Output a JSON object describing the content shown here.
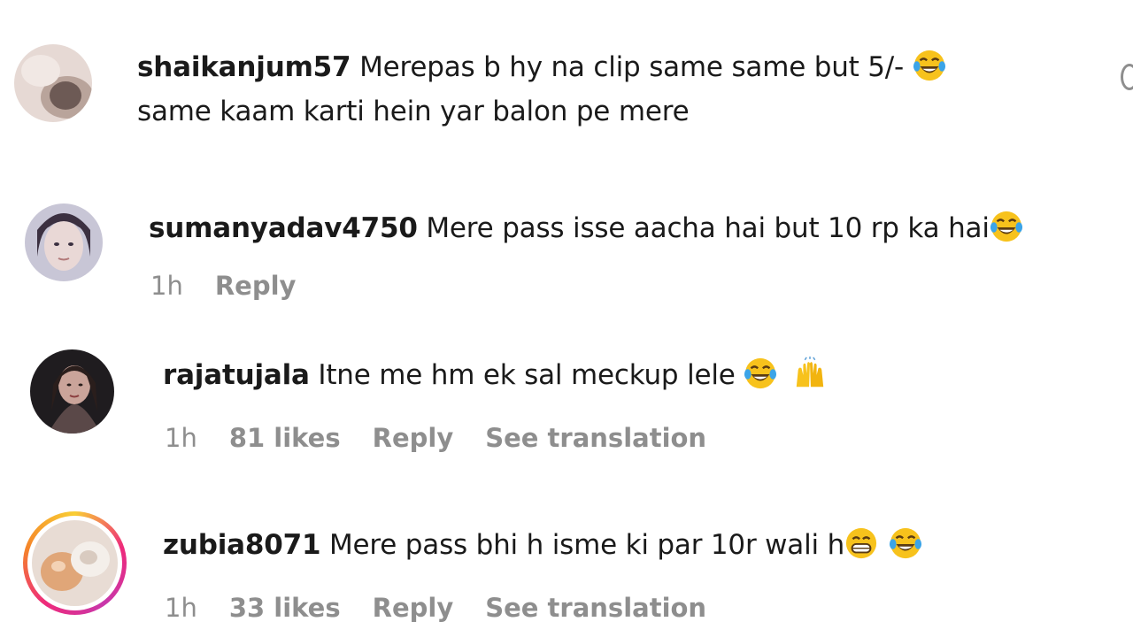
{
  "comments": [
    {
      "username": "shaikanjum57",
      "text_line1": " Merepas b hy na clip same same but 5/- ",
      "text_line2": "same kaam karti hein yar balon pe mere",
      "emoji": "face-with-tears-of-joy"
    },
    {
      "username": "sumanyadav4750",
      "text": " Mere pass isse aacha hai but 10 rp ka hai",
      "emoji": "face-with-tears-of-joy",
      "time": "1h",
      "reply": "Reply"
    },
    {
      "username": "rajatujala",
      "text": " Itne me hm ek sal meckup lele ",
      "emojis": [
        "face-with-tears-of-joy",
        "raising-hands"
      ],
      "time": "1h",
      "likes": "81 likes",
      "reply": "Reply",
      "translate": "See translation"
    },
    {
      "username": "zubia8071",
      "text": " Mere pass bhi h isme ki par 10r wali h",
      "emojis": [
        "grinning-face",
        "face-with-tears-of-joy"
      ],
      "time": "1h",
      "likes": "33 likes",
      "reply": "Reply",
      "translate": "See translation",
      "story_ring": true
    }
  ],
  "colors": {
    "meta_gray": "#8e8e8e",
    "text": "#1a1a1a",
    "emoji_yellow": "#f7c21c"
  }
}
